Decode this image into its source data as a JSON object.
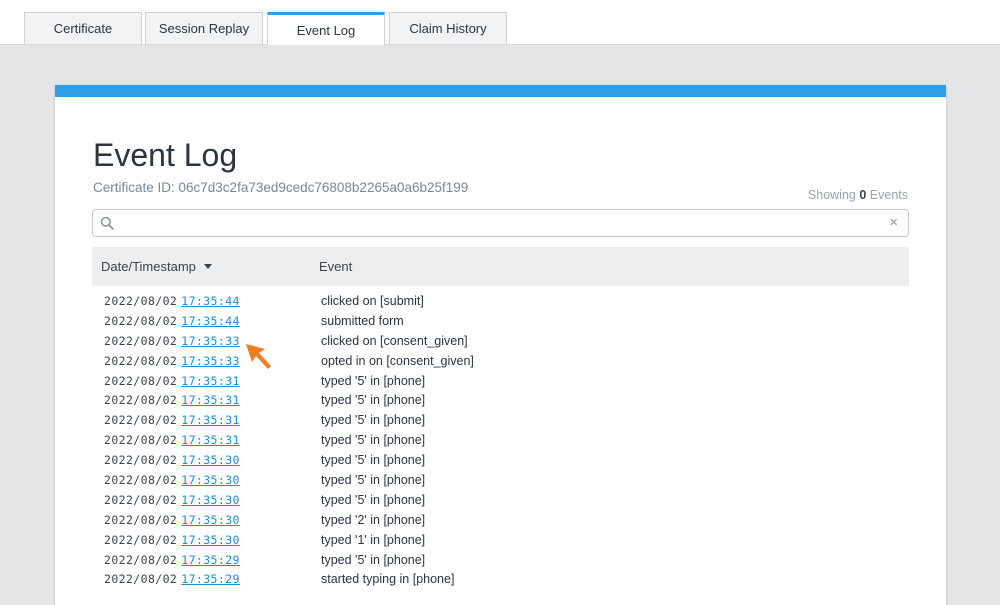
{
  "tabs": [
    {
      "label": "Certificate",
      "active": false
    },
    {
      "label": "Session Replay",
      "active": false
    },
    {
      "label": "Event Log",
      "active": true
    },
    {
      "label": "Claim History",
      "active": false
    }
  ],
  "header": {
    "title": "Event Log",
    "certificate_id": "Certificate ID: 06c7d3c2fa73ed9cedc76808b2265a0a6b25f199",
    "showing_prefix": "Showing",
    "showing_count": "0",
    "showing_suffix": "Events"
  },
  "search": {
    "value": "",
    "placeholder": "",
    "clear_glyph": "×"
  },
  "table": {
    "columns": [
      "Date/Timestamp",
      "Event"
    ],
    "rows": [
      {
        "date": "2022/08/02",
        "time": "17:35:44",
        "event": "clicked on [submit]"
      },
      {
        "date": "2022/08/02",
        "time": "17:35:44",
        "event": "submitted form"
      },
      {
        "date": "2022/08/02",
        "time": "17:35:33",
        "event": "clicked on [consent_given]"
      },
      {
        "date": "2022/08/02",
        "time": "17:35:33",
        "event": "opted in on [consent_given]"
      },
      {
        "date": "2022/08/02",
        "time": "17:35:31",
        "event": "typed '5' in [phone]"
      },
      {
        "date": "2022/08/02",
        "time": "17:35:31",
        "event": "typed '5' in [phone]"
      },
      {
        "date": "2022/08/02",
        "time": "17:35:31",
        "event": "typed '5' in [phone]"
      },
      {
        "date": "2022/08/02",
        "time": "17:35:31",
        "event": "typed '5' in [phone]"
      },
      {
        "date": "2022/08/02",
        "time": "17:35:30",
        "event": "typed '5' in [phone]"
      },
      {
        "date": "2022/08/02",
        "time": "17:35:30",
        "event": "typed '5' in [phone]"
      },
      {
        "date": "2022/08/02",
        "time": "17:35:30",
        "event": "typed '5' in [phone]"
      },
      {
        "date": "2022/08/02",
        "time": "17:35:30",
        "event": "typed '2' in [phone]"
      },
      {
        "date": "2022/08/02",
        "time": "17:35:30",
        "event": "typed '1' in [phone]"
      },
      {
        "date": "2022/08/02",
        "time": "17:35:29",
        "event": "typed '5' in [phone]"
      },
      {
        "date": "2022/08/02",
        "time": "17:35:29",
        "event": "started typing in [phone]"
      }
    ]
  },
  "colors": {
    "accent": "#2ea0e6",
    "link": "#1a8fd6",
    "cursor": "#f47d20"
  },
  "icons": {
    "search": "search-icon",
    "clear": "close-icon",
    "sort": "caret-down-icon",
    "pointer": "cursor-arrow-icon"
  }
}
